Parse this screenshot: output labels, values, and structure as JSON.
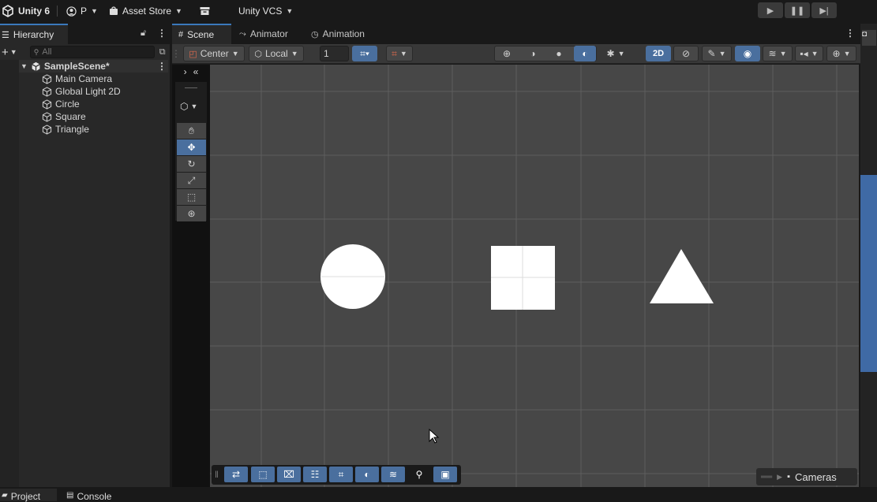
{
  "topbar": {
    "app_title": "Unity 6",
    "account_label": "P",
    "asset_store_label": "Asset Store",
    "vcs_label": "Unity VCS"
  },
  "hierarchy": {
    "tab_label": "Hierarchy",
    "search_placeholder": "All",
    "scene_name": "SampleScene*",
    "items": [
      "Main Camera",
      "Global Light 2D",
      "Circle",
      "Square",
      "Triangle"
    ]
  },
  "scene_tabs": {
    "scene": "Scene",
    "animator": "Animator",
    "animation": "Animation"
  },
  "scene_toolbar": {
    "pivot": "Center",
    "space": "Local",
    "grid_size": "1",
    "mode_2d": "2D"
  },
  "overlays": {
    "cameras_label": "Cameras"
  },
  "bottom_tabs": {
    "project": "Project",
    "console": "Console"
  },
  "colors": {
    "accent": "#4a6f9e",
    "viewport": "#474747",
    "shape_fill": "#ffffff"
  }
}
